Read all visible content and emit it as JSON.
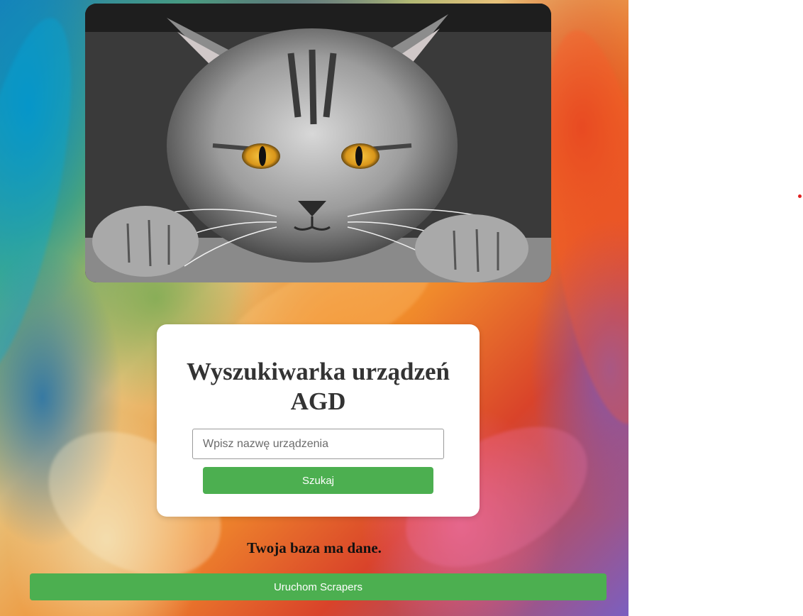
{
  "hero_image": {
    "subject": "kitten-photo"
  },
  "search_card": {
    "title": "Wyszukiwarka urządzeń AGD",
    "input_placeholder": "Wpisz nazwę urządzenia",
    "input_value": "",
    "search_button_label": "Szukaj"
  },
  "status": {
    "message": "Twoja baza ma dane."
  },
  "actions": {
    "run_scrapers_label": "Uruchom Scrapers"
  },
  "colors": {
    "button_green": "#4caf50",
    "card_background": "#ffffff",
    "marker_red": "#e02020"
  }
}
